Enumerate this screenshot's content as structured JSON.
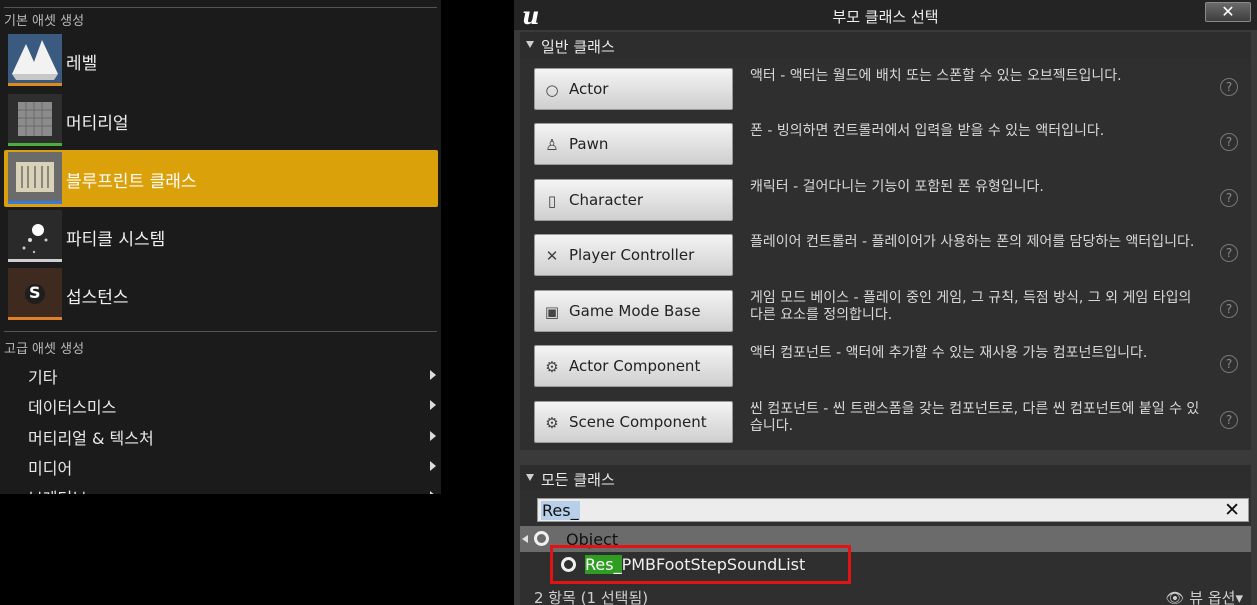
{
  "menu": {
    "basic_header": "기본 애셋 생성",
    "basic_items": [
      {
        "label": "레벨",
        "icon": "level-icon",
        "bar": "#e08a1a"
      },
      {
        "label": "머티리얼",
        "icon": "material-icon",
        "bar": "#4cae3a"
      },
      {
        "label": "블루프린트 클래스",
        "icon": "blueprint-icon",
        "bar": "#3a79d6",
        "selected": true
      },
      {
        "label": "파티클 시스템",
        "icon": "particle-icon",
        "bar": "#cfcfcf"
      },
      {
        "label": "섭스턴스",
        "icon": "substance-icon",
        "bar": "#e0802a",
        "glyph": "S"
      }
    ],
    "advanced_header": "고급 애셋 생성",
    "advanced_items": [
      "기타",
      "데이터스미스",
      "머티리얼 & 텍스처",
      "미디어",
      "브레더브"
    ]
  },
  "dialog": {
    "title": "부모 클래스 선택",
    "close": "✕",
    "common_header": "일반 클래스",
    "classes": [
      {
        "name": "Actor",
        "desc": "액터 - 액터는 월드에 배치 또는 스폰할 수 있는 오브젝트입니다.",
        "icon": "○"
      },
      {
        "name": "Pawn",
        "desc": "폰 - 빙의하면 컨트롤러에서 입력을 받을 수 있는 액터입니다.",
        "icon": "♙"
      },
      {
        "name": "Character",
        "desc": "캐릭터 - 걸어다니는 기능이 포함된 폰 유형입니다.",
        "icon": "▯"
      },
      {
        "name": "Player Controller",
        "desc": "플레이어 컨트롤러 - 플레이어가 사용하는 폰의 제어를 담당하는 액터입니다.",
        "icon": "✕"
      },
      {
        "name": "Game Mode Base",
        "desc": "게임 모드 베이스 - 플레이 중인 게임, 그 규칙, 득점 방식, 그 외 게임 타입의 다른 요소를 정의합니다.",
        "icon": "▣"
      },
      {
        "name": "Actor Component",
        "desc": "액터 컴포넌트 - 액터에 추가할 수 있는 재사용 가능 컴포넌트입니다.",
        "icon": "⚙"
      },
      {
        "name": "Scene Component",
        "desc": "씬 컴포넌트 - 씬 트랜스폼을 갖는 컴포넌트로, 다른 씬 컴포넌트에 붙일 수 있습니다.",
        "icon": "⚙"
      }
    ],
    "help": "?",
    "all_header": "모든 클래스",
    "search_value": "Res_",
    "search_clear": "✕",
    "tree_root": "Object",
    "tree_child_highlight": "Res_",
    "tree_child_rest": "PMBFootStepSoundList",
    "status": "2 항목 (1 선택됨)",
    "view_options": "👁 뷰 옵션▾"
  }
}
